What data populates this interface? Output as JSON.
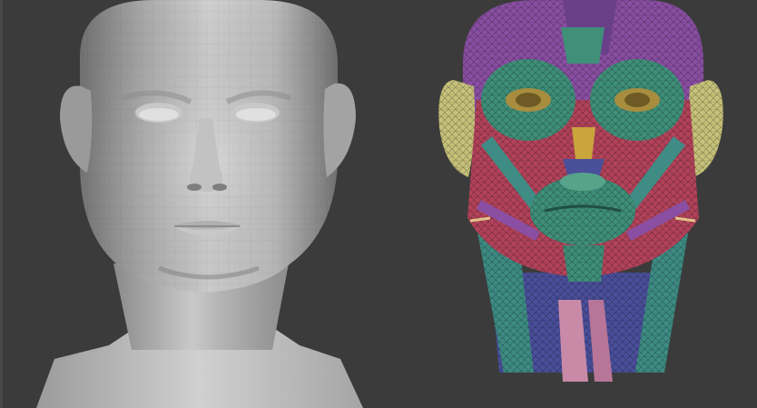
{
  "viewport": {
    "background_color": "#3b3b3b"
  },
  "models": [
    {
      "name": "base-head-mesh",
      "material": "grey-clay",
      "colors": {
        "light": "#d4d4d4",
        "mid": "#a9a9a9",
        "dark": "#6f6f6f",
        "shadow": "#4d4d4d"
      }
    },
    {
      "name": "facial-muscle-anatomy-mesh",
      "material": "wireframe-colored",
      "colors": {
        "cranial": "#8a4fa3",
        "facial_green": "#3f8f79",
        "muscle_red": "#b2435a",
        "ear_yellow": "#c7c27a",
        "eye_gold": "#a88d3f",
        "neck_blue": "#4a4f9a",
        "neck_teal": "#3e8c84",
        "tendon_pink": "#c98aa8"
      }
    }
  ]
}
